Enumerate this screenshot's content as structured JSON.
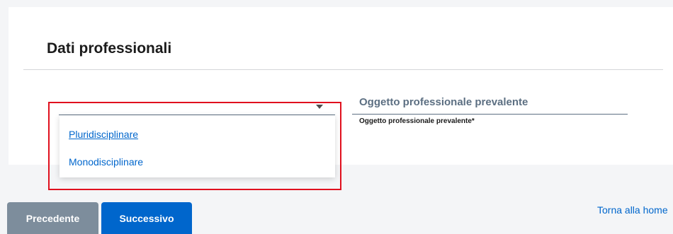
{
  "section": {
    "title": "Dati professionali"
  },
  "select": {
    "value": "",
    "options": [
      "Pluridisciplinare",
      "Monodisciplinare"
    ]
  },
  "field": {
    "value": "Oggetto professionale prevalente",
    "label": "Oggetto professionale prevalente*"
  },
  "nav": {
    "prev_label": "Precedente",
    "next_label": "Successivo",
    "home_link": "Torna alla home"
  },
  "colors": {
    "accent": "#0066cc",
    "prev_button": "#7d8d9c",
    "highlight": "#e0101e"
  },
  "icons": {
    "select_arrow": "caret-down-icon"
  }
}
